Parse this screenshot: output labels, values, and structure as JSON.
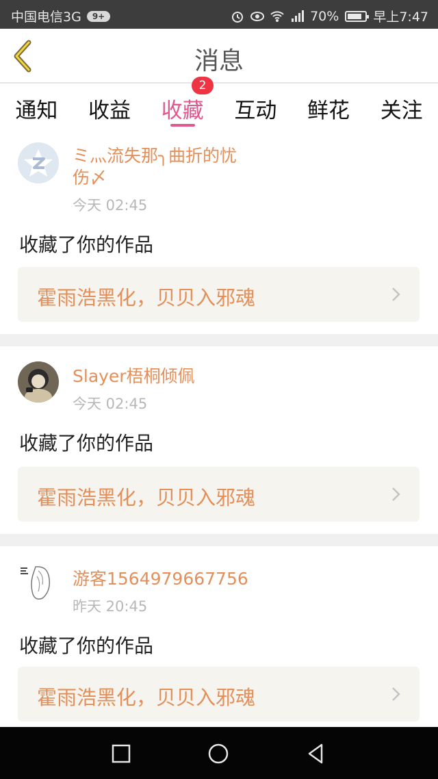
{
  "status": {
    "carrier": "中国电信3G",
    "notif_badge": "9+",
    "battery": "70%",
    "time": "早上7:47"
  },
  "header": {
    "title": "消息",
    "back_icon": "chevron-left-icon",
    "accent": "#e0588e"
  },
  "tabs": [
    {
      "label": "通知"
    },
    {
      "label": "收益"
    },
    {
      "label": "收藏",
      "badge": "2",
      "active": true
    },
    {
      "label": "互动"
    },
    {
      "label": "鲜花"
    },
    {
      "label": "关注"
    }
  ],
  "messages": [
    {
      "user": "ミ灬流失那╮曲折的忧伤〆",
      "user_line1": "ミ灬流失那╮曲折的忧",
      "user_line2": "伤〆",
      "time": "今天 02:45",
      "action": "收藏了你的作品",
      "work": "霍雨浩黑化，贝贝入邪魂"
    },
    {
      "user": "Slayer梧桐倾佩",
      "time": "今天 02:45",
      "action": "收藏了你的作品",
      "work": "霍雨浩黑化，贝贝入邪魂"
    },
    {
      "user": "游客1564979667756",
      "time": "昨天 20:45",
      "action": "收藏了你的作品",
      "work": "霍雨浩黑化，贝贝入邪魂"
    }
  ],
  "colors": {
    "username": "#e48f59",
    "time": "#b7b7b7",
    "work_bg": "#f5f4ef"
  }
}
